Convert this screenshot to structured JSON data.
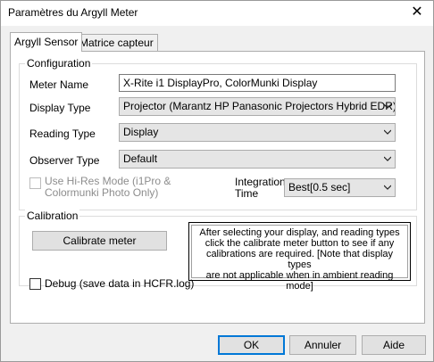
{
  "window": {
    "title": "Paramètres du Argyll Meter",
    "close_glyph": "✕"
  },
  "tabs": [
    {
      "label": "Argyll Sensor",
      "active": true
    },
    {
      "label": "Matrice capteur",
      "active": false
    }
  ],
  "configuration": {
    "group_label": "Configuration",
    "meter_name": {
      "label": "Meter Name",
      "value": "X-Rite i1 DisplayPro, ColorMunki Display"
    },
    "display_type": {
      "label": "Display Type",
      "selected": "Projector (Marantz HP Panasonic Projectors Hybrid EDR)"
    },
    "reading_type": {
      "label": "Reading Type",
      "selected": "Display"
    },
    "observer_type": {
      "label": "Observer Type",
      "selected": "Default"
    },
    "hi_res": {
      "label_line1": "Use Hi-Res Mode (i1Pro &",
      "label_line2": "Colormunki Photo Only)",
      "checked": false,
      "enabled": false
    },
    "integration_time": {
      "label_line1": "Integration",
      "label_line2": "Time",
      "selected": "Best[0.5 sec]"
    }
  },
  "calibration": {
    "group_label": "Calibration",
    "button_label": "Calibrate meter",
    "info_lines": [
      "After selecting your display, and reading types",
      "click the calibrate meter button to see if any",
      "calibrations are required. [Note that display types",
      "are not applicable when in ambient reading mode]"
    ]
  },
  "debug": {
    "label": "Debug (save data in HCFR.log)",
    "checked": false
  },
  "footer": {
    "ok_label": "OK",
    "cancel_label": "Annuler",
    "help_label": "Aide"
  }
}
